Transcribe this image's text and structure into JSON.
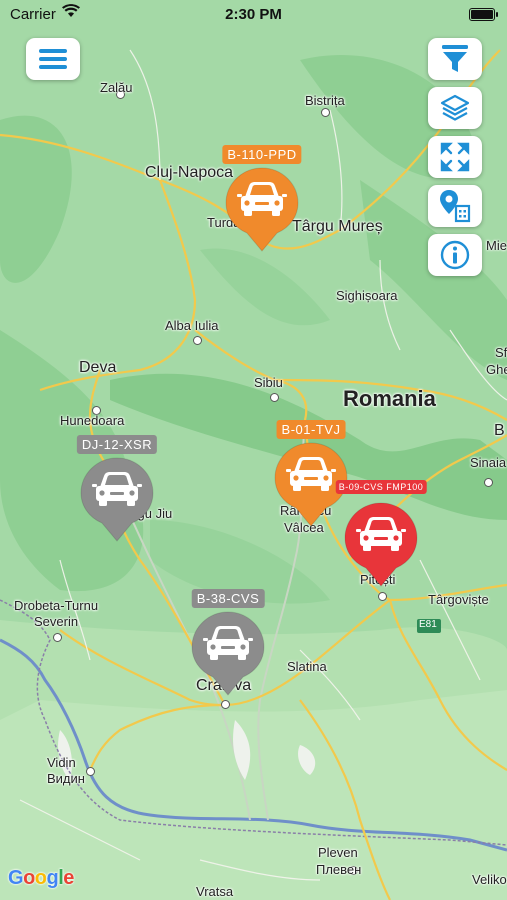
{
  "status_bar": {
    "carrier": "Carrier",
    "time": "2:30 PM"
  },
  "controls": {
    "menu": "menu-icon",
    "filter": "filter-icon",
    "layers": "layers-icon",
    "fit": "expand-icon",
    "place": "pin-building-icon",
    "info": "info-icon",
    "accent": "#1f8fd6"
  },
  "map_labels": {
    "zalau": "Zalău",
    "bistrita": "Bistrița",
    "cluj": "Cluj-Napoca",
    "turda": "Turda",
    "targu_mures": "Târgu Mureș",
    "mie": "Mie",
    "sighisoara": "Sighișoara",
    "alba_iulia": "Alba Iulia",
    "deva": "Deva",
    "sibiu": "Sibiu",
    "romania": "Romania",
    "sf": "Sf",
    "ghe": "Ghe",
    "hunedoara": "Hunedoara",
    "b": "B",
    "sinaia": "Sinaia",
    "targu_jiu": "Târgu Jiu",
    "ramnicu": "Râmnicu",
    "valcea": "Vâlcea",
    "pitesti": "Pitești",
    "targoviste": "Târgoviște",
    "drobeta1": "Drobeta-Turnu",
    "drobeta2": "Severin",
    "e81": "E81",
    "slatina": "Slatina",
    "craiova": "Craiova",
    "vidin": "Vidin",
    "vidin_cyr": "Видин",
    "pleven": "Pleven",
    "pleven_cyr": "Плевен",
    "vratsa": "Vratsa",
    "veliko": "Veliko",
    "google": "Google"
  },
  "vehicles": [
    {
      "plate": "B-110-PPD",
      "status_color": "#f08a2c"
    },
    {
      "plate": "DJ-12-XSR",
      "status_color": "#8c8c8c"
    },
    {
      "plate": "B-01-TVJ",
      "status_color": "#f08a2c"
    },
    {
      "plate": "B-09-CVS FMP100",
      "status_color": "#e8353a"
    },
    {
      "plate": "B-38-CVS",
      "status_color": "#8c8c8c"
    }
  ]
}
